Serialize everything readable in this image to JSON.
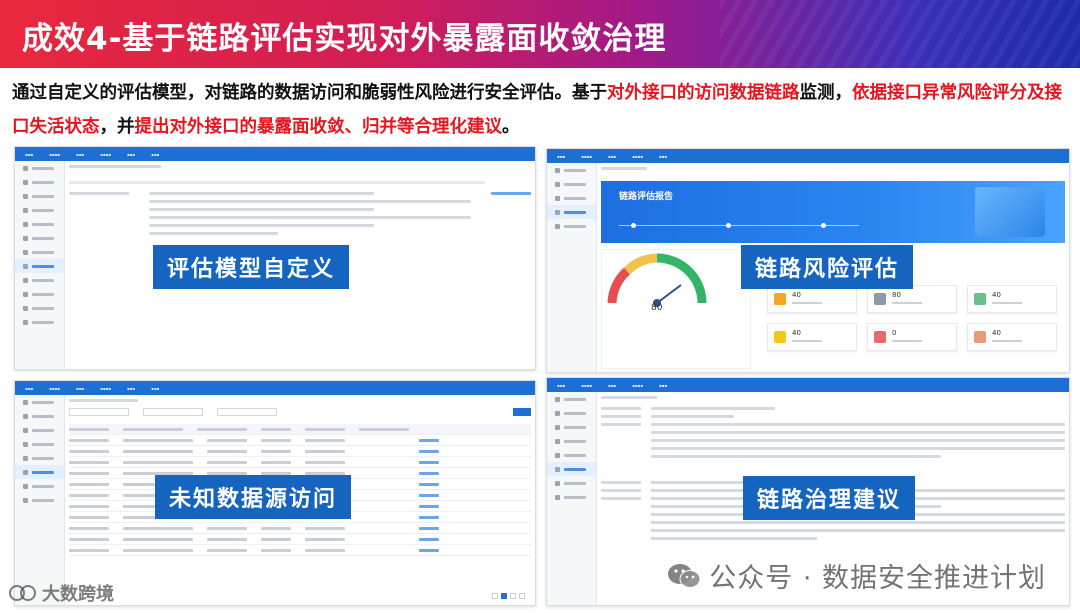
{
  "header": {
    "title": "成效4-基于链路评估实现对外暴露面收敛治理"
  },
  "intro": {
    "seg1": "通过自定义的评估模型，对链路的数据访问和脆弱性风险进行安全评估。基于",
    "seg2": "对外接口的访问数据链路",
    "seg3": "监测，",
    "seg4": "依据接口异常风险评分及接口失活状态",
    "seg5": "，并",
    "seg6": "提出对外接口的暴露面收敛、归并等合理化建议",
    "seg7": "。"
  },
  "panels": {
    "p1_label": "评估模型自定义",
    "p2_label": "链路风险评估",
    "p3_label": "未知数据源访问",
    "p4_label": "链路治理建议"
  },
  "report": {
    "title": "链路评估报告",
    "gauge_value": "80",
    "cards": [
      "40",
      "80",
      "40",
      "40",
      "0",
      "40"
    ]
  },
  "watermark": {
    "text": "公众号 · 数据安全推进计划",
    "logo": "大数跨境"
  },
  "colors": {
    "accent_red": "#e8141e",
    "label_blue": "#1565c0",
    "nav_blue": "#1e6fd4"
  }
}
